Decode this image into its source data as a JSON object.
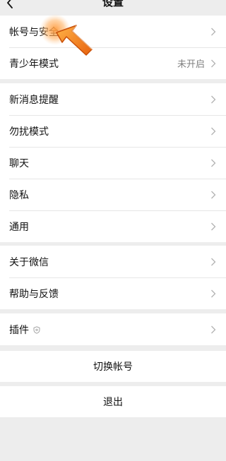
{
  "header": {
    "title": "设置",
    "back_icon": "chevron-left-icon"
  },
  "groups": [
    {
      "items": [
        {
          "label": "帐号与安全"
        },
        {
          "label": "青少年模式",
          "value": "未开启"
        }
      ]
    },
    {
      "items": [
        {
          "label": "新消息提醒"
        },
        {
          "label": "勿扰模式"
        },
        {
          "label": "聊天"
        },
        {
          "label": "隐私"
        },
        {
          "label": "通用"
        }
      ]
    },
    {
      "items": [
        {
          "label": "关于微信"
        },
        {
          "label": "帮助与反馈"
        }
      ]
    },
    {
      "items": [
        {
          "label": "插件",
          "icon": "shield-icon"
        }
      ]
    }
  ],
  "actions": {
    "switch_account": "切换帐号",
    "logout": "退出"
  },
  "colors": {
    "background": "#ededed",
    "row": "#ffffff",
    "secondary_text": "#808080",
    "pointer_orange": "#f57c1f"
  },
  "overlay": {
    "icon": "pointing-arrow-icon"
  }
}
